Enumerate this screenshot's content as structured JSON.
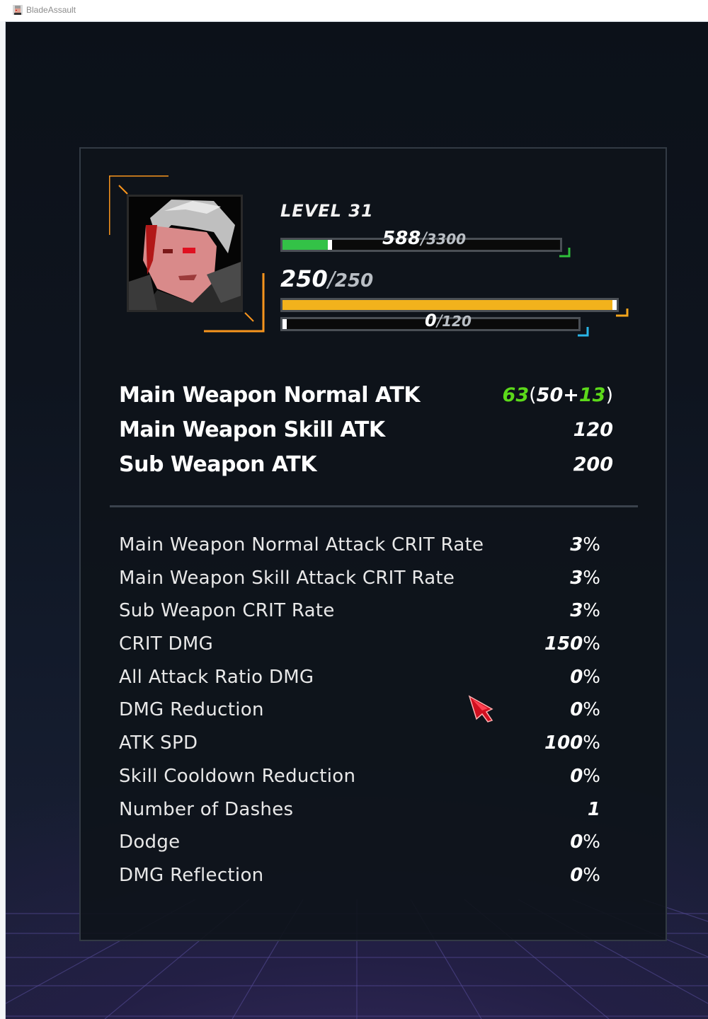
{
  "window": {
    "title": "BladeAssault"
  },
  "character": {
    "level_label": "LEVEL 31",
    "exp": {
      "current": "588",
      "max": "3300",
      "fraction": 0.178
    },
    "hp": {
      "current": "250",
      "max": "250",
      "fraction": 1.0
    },
    "energy": {
      "current": "0",
      "max": "120",
      "fraction": 0.0
    }
  },
  "attack": [
    {
      "label": "Main Weapon Normal ATK",
      "total": "63",
      "base": "50",
      "bonus": "13"
    },
    {
      "label": "Main Weapon Skill ATK",
      "value": "120"
    },
    {
      "label": "Sub Weapon ATK",
      "value": "200"
    }
  ],
  "stats": [
    {
      "label": "Main Weapon Normal Attack CRIT Rate",
      "value": "3",
      "unit": "%"
    },
    {
      "label": "Main Weapon Skill Attack CRIT Rate",
      "value": "3",
      "unit": "%"
    },
    {
      "label": "Sub Weapon CRIT Rate",
      "value": "3",
      "unit": "%"
    },
    {
      "label": "CRIT DMG",
      "value": "150",
      "unit": "%"
    },
    {
      "label": "All Attack Ratio DMG",
      "value": "0",
      "unit": "%"
    },
    {
      "label": "DMG Reduction",
      "value": "0",
      "unit": "%"
    },
    {
      "label": "ATK SPD",
      "value": "100",
      "unit": "%"
    },
    {
      "label": "Skill Cooldown Reduction",
      "value": "0",
      "unit": "%"
    },
    {
      "label": "Number of Dashes",
      "value": "1",
      "unit": ""
    },
    {
      "label": "Dodge",
      "value": "0",
      "unit": "%"
    },
    {
      "label": "DMG Reflection",
      "value": "0",
      "unit": "%"
    }
  ],
  "colors": {
    "exp_bar": "#33c247",
    "hp_bar": "#f2b21c",
    "portrait_frame": "#f7941d",
    "exp_corner": "#2fbf3a",
    "hp_corner": "#f2a51c",
    "energy_corner": "#29b6e8",
    "bonus_green": "#5cd91a"
  },
  "icons": {
    "app": "character-portrait-icon",
    "cursor": "red-arrow-cursor-icon"
  }
}
